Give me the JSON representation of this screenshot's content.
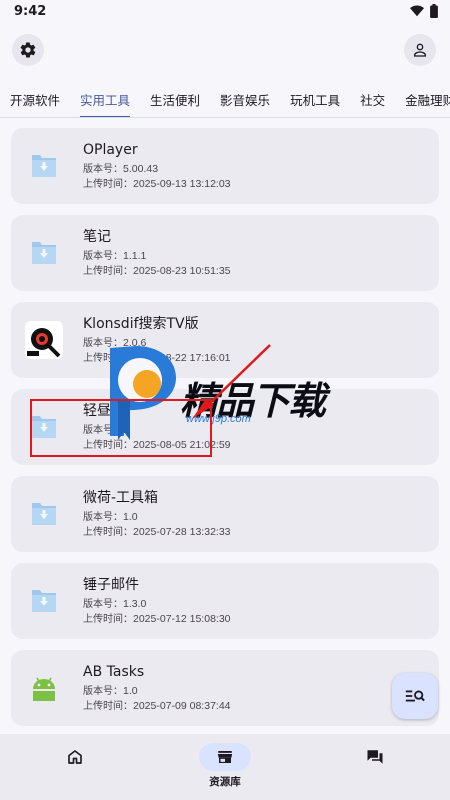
{
  "status_bar": {
    "time": "9:42"
  },
  "tabs": [
    "开源软件",
    "实用工具",
    "生活便利",
    "影音娱乐",
    "玩机工具",
    "社交",
    "金融理财"
  ],
  "active_tab": 1,
  "meta_labels": {
    "version": "版本号：",
    "upload": "上传时间："
  },
  "apps": [
    {
      "name": "OPlayer",
      "version": "5.00.43",
      "uploaded": "2025-09-13 13:12:03",
      "icon": "download-box-icon"
    },
    {
      "name": "笔记",
      "version": "1.1.1",
      "uploaded": "2025-08-23 10:51:35",
      "icon": "download-box-icon"
    },
    {
      "name": "Klonsdif搜索TV版",
      "version": "2.0.6",
      "uploaded": "2025-08-22 17:16:01",
      "icon": "klonsdif-logo-icon"
    },
    {
      "name": "轻昼",
      "version": "1",
      "uploaded": "2025-08-05 21:02:59",
      "icon": "download-box-icon"
    },
    {
      "name": "微荷-工具箱",
      "version": "1.0",
      "uploaded": "2025-07-28 13:32:33",
      "icon": "download-box-icon"
    },
    {
      "name": "锤子邮件",
      "version": "1.3.0",
      "uploaded": "2025-07-12 15:08:30",
      "icon": "download-box-icon"
    },
    {
      "name": "AB Tasks",
      "version": "1.0",
      "uploaded": "2025-07-09 08:37:44",
      "icon": "android-icon"
    }
  ],
  "watermark": {
    "text": "精品下载",
    "url": "www.j9p.com"
  },
  "bottom_nav": [
    {
      "label": "",
      "icon": "home-icon"
    },
    {
      "label": "资源库",
      "icon": "store-icon"
    },
    {
      "label": "",
      "icon": "forum-icon"
    }
  ],
  "active_nav": 1,
  "colors": {
    "accent": "#4a5c9c",
    "card": "#eceaf1",
    "fab": "#d9e2ff",
    "highlight": "#e0191b"
  }
}
